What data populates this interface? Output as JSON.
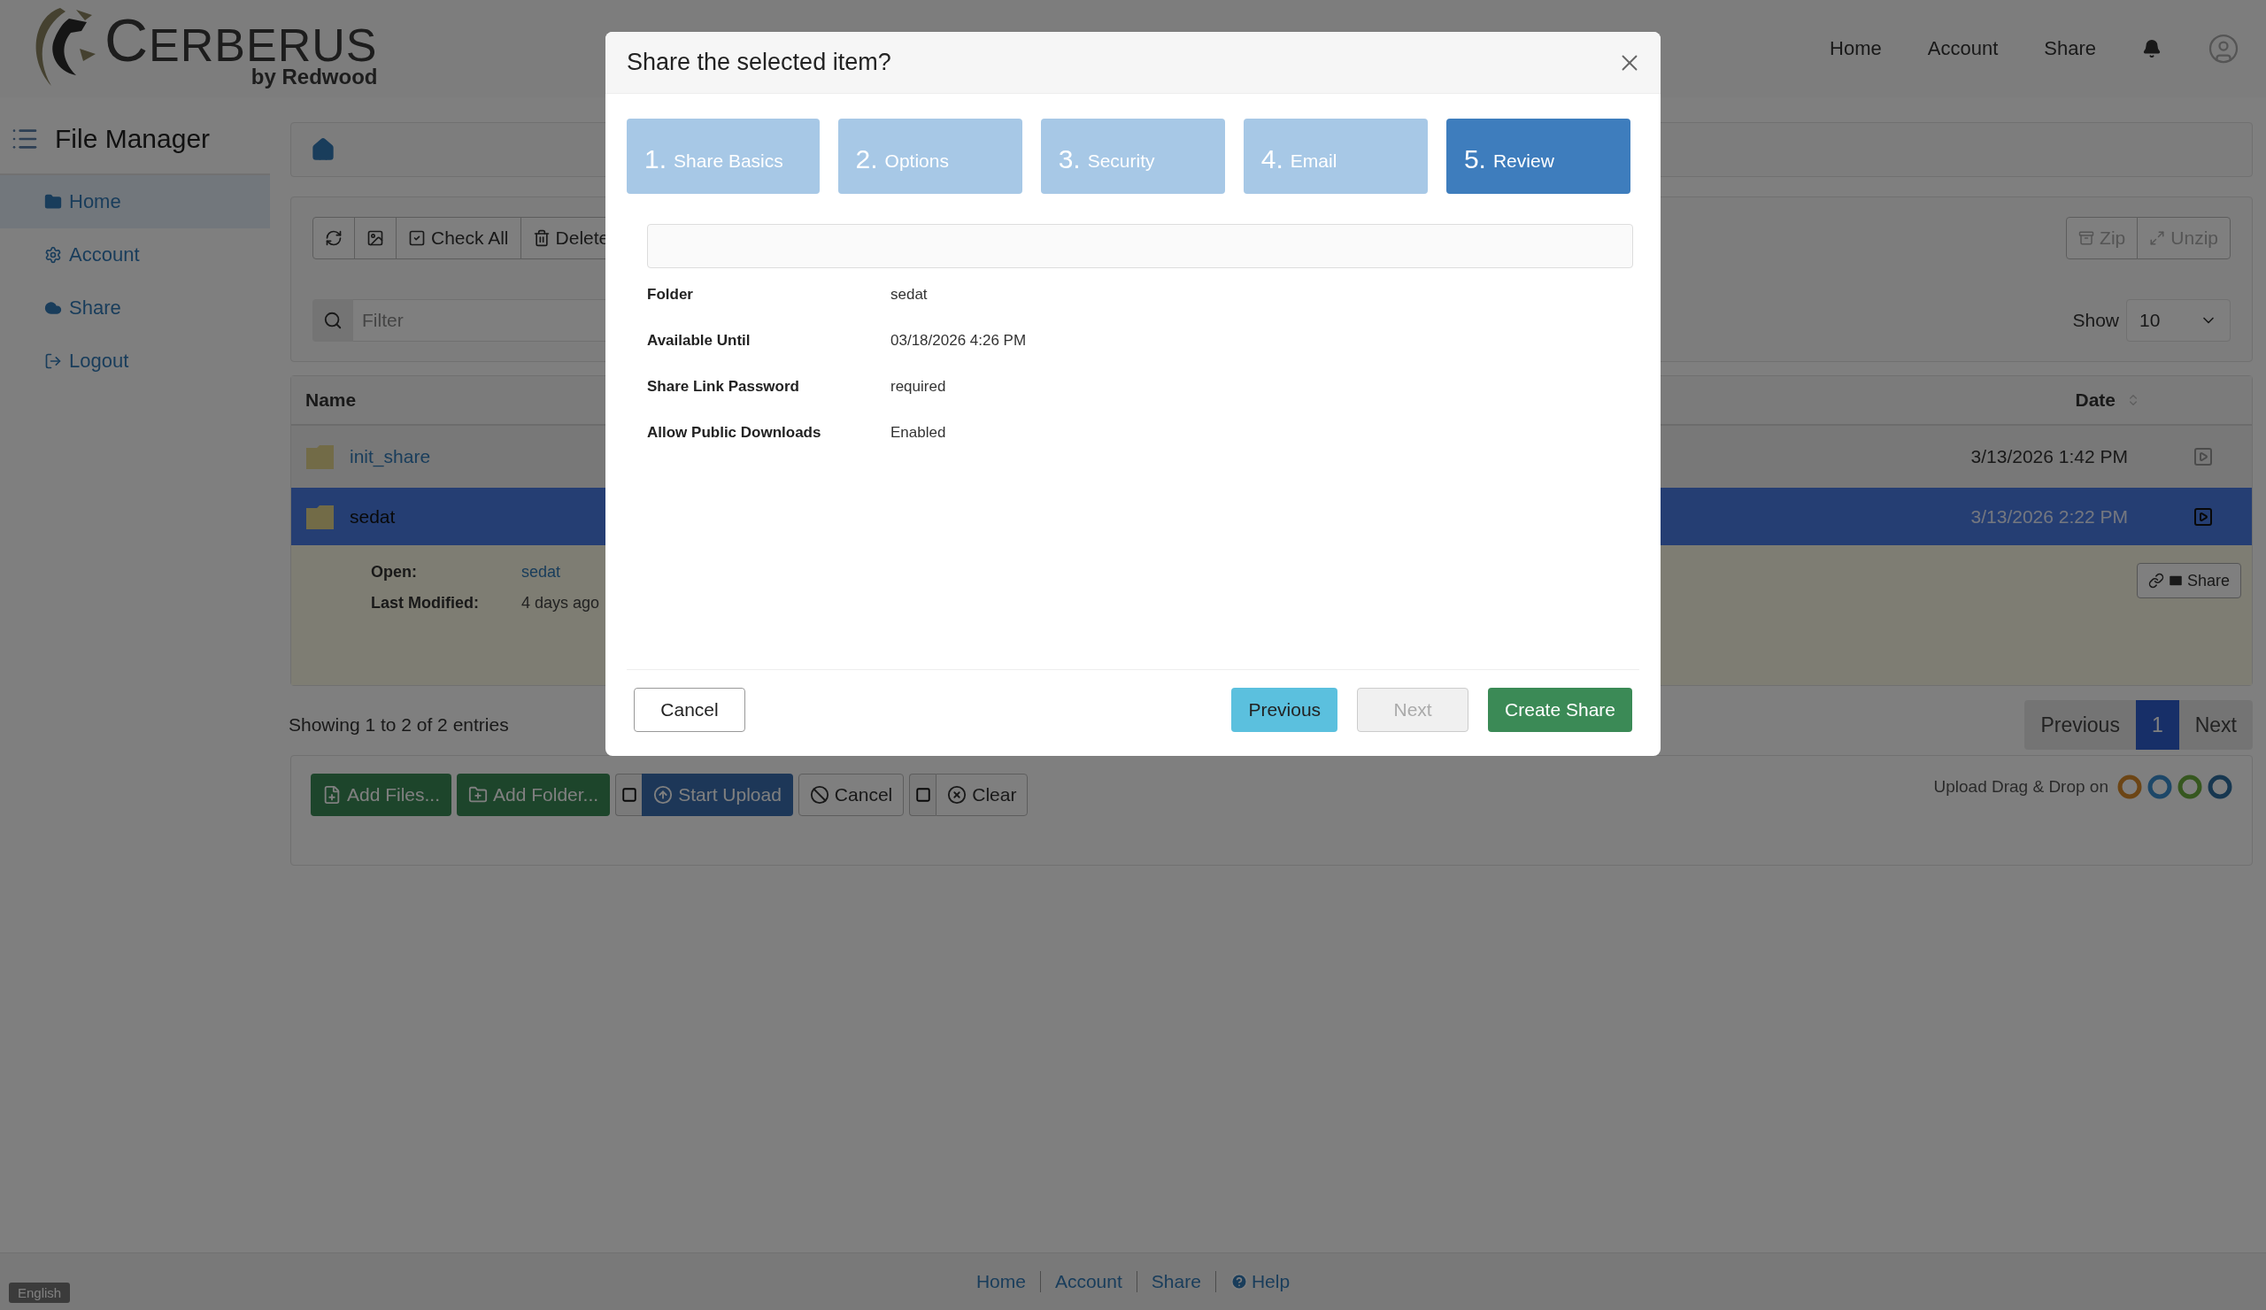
{
  "header": {
    "logo": {
      "title": "CERBERUS",
      "subtitle": "by Redwood"
    },
    "nav": [
      {
        "label": "Home"
      },
      {
        "label": "Account"
      },
      {
        "label": "Share"
      }
    ]
  },
  "sidebar": {
    "title": "File Manager",
    "items": [
      {
        "label": "Home",
        "selected": true
      },
      {
        "label": "Account",
        "selected": false
      },
      {
        "label": "Share",
        "selected": false
      },
      {
        "label": "Logout",
        "selected": false
      }
    ]
  },
  "toolbar": {
    "buttons": [
      {
        "label": "Check All"
      },
      {
        "label": "Delete"
      }
    ],
    "right_buttons": [
      {
        "label": "Zip",
        "disabled": true
      },
      {
        "label": "Unzip",
        "disabled": true
      }
    ]
  },
  "filter": {
    "placeholder": "Filter"
  },
  "show": {
    "label": "Show",
    "value": "10"
  },
  "table": {
    "columns": [
      {
        "label": "Name"
      },
      {
        "label": "Date"
      }
    ],
    "rows": [
      {
        "name": "init_share",
        "date": "3/13/2026 1:42 PM",
        "selected": false
      },
      {
        "name": "sedat",
        "date": "3/13/2026 2:22 PM",
        "selected": true,
        "details": [
          {
            "label": "Open:",
            "value": "sedat",
            "link": true
          },
          {
            "label": "Last Modified:",
            "value": "4 days ago",
            "link": false
          }
        ],
        "share_button": "Share"
      }
    ]
  },
  "entries": "Showing 1 to 2 of 2 entries",
  "pagination": {
    "previous": "Previous",
    "pages": [
      {
        "label": "1",
        "selected": true
      }
    ],
    "next": "Next"
  },
  "upload": {
    "buttons": [
      {
        "label": "Add Files...",
        "kind": "success"
      },
      {
        "label": "Add Folder...",
        "kind": "success"
      },
      {
        "label": "Start Upload",
        "kind": "primary",
        "checked": false
      },
      {
        "label": "Cancel",
        "kind": "default"
      },
      {
        "label": "Clear",
        "kind": "default",
        "checked": false
      }
    ],
    "note": "Upload Drag & Drop on"
  },
  "footer": {
    "language": "English",
    "links": [
      {
        "label": "Home"
      },
      {
        "label": "Account"
      },
      {
        "label": "Share"
      },
      {
        "label": "Help"
      }
    ]
  },
  "dialog": {
    "title": "Share the selected item?",
    "steps": [
      {
        "number": "1.",
        "label": "Share Basics",
        "selected": false
      },
      {
        "number": "2.",
        "label": "Options",
        "selected": false
      },
      {
        "number": "3.",
        "label": "Security",
        "selected": false
      },
      {
        "number": "4.",
        "label": "Email",
        "selected": false
      },
      {
        "number": "5.",
        "label": "Review",
        "selected": true
      }
    ],
    "details": [
      {
        "label": "Folder",
        "value": "sedat"
      },
      {
        "label": "Available Until",
        "value": "03/18/2026 4:26 PM"
      },
      {
        "label": "Share Link Password",
        "value": "required"
      },
      {
        "label": "Allow Public Downloads",
        "value": "Enabled"
      }
    ],
    "cancel": "Cancel",
    "buttons": [
      {
        "label": "Previous",
        "kind": "info",
        "disabled": false
      },
      {
        "label": "Next",
        "kind": "default",
        "disabled": true
      },
      {
        "label": "Create Share",
        "kind": "success",
        "disabled": false
      }
    ]
  }
}
